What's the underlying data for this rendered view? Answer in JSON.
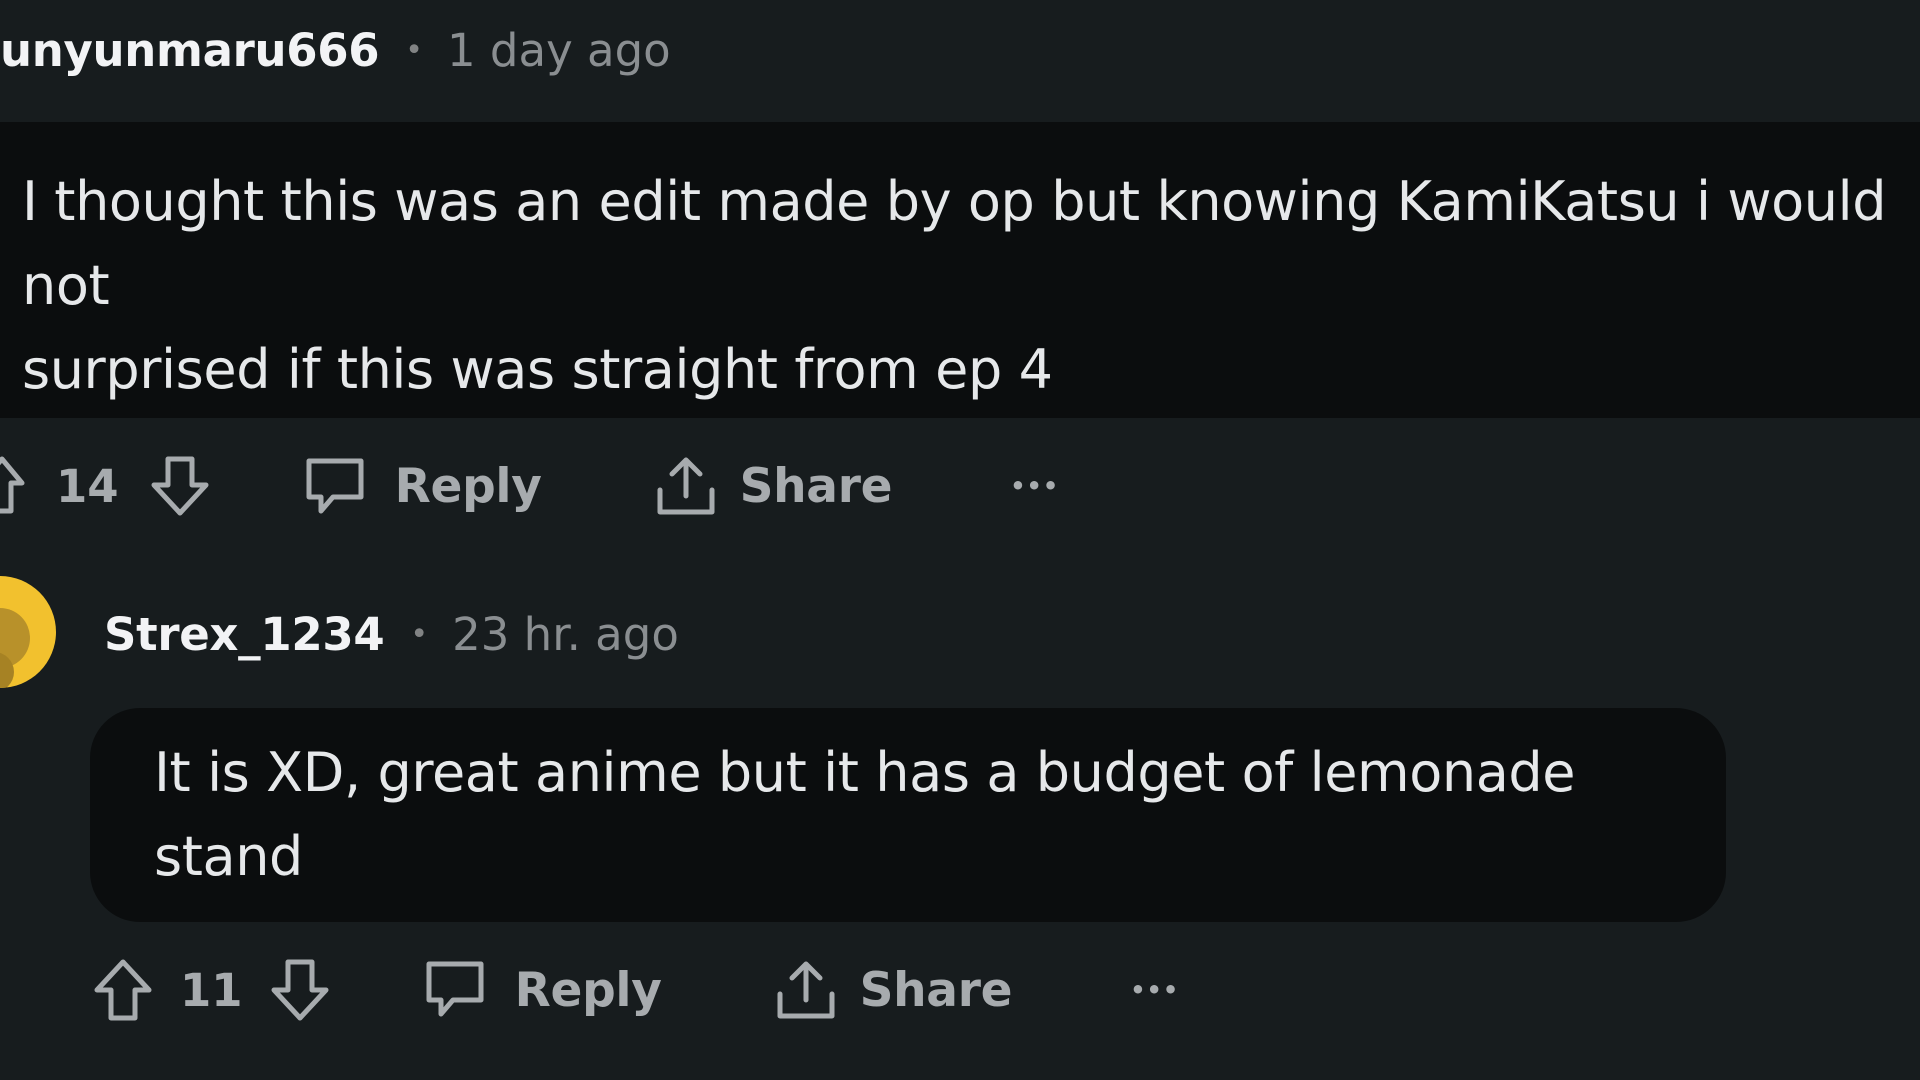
{
  "comment1": {
    "username": "unyunmaru666",
    "separator": "•",
    "time": "1 day ago",
    "text_line1": "I thought this was an edit made by op but knowing KamiKatsu i would not",
    "text_line2": "surprised if this was straight from ep 4",
    "score": "14",
    "reply_label": "Reply",
    "share_label": "Share",
    "more_label": "•••"
  },
  "comment2": {
    "username": "Strex_1234",
    "separator": "•",
    "time": "23 hr. ago",
    "text": "It is XD, great anime but it has a budget of lemonade stand",
    "score": "11",
    "reply_label": "Reply",
    "share_label": "Share",
    "more_label": "•••"
  },
  "colors": {
    "background": "#171c1e",
    "bubble": "#0b0d0e",
    "avatar": "#f2c12e"
  }
}
